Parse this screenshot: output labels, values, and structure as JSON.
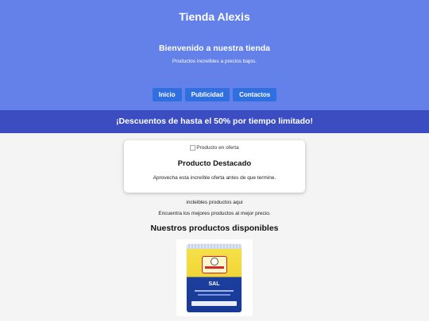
{
  "header": {
    "store_title": "Tienda Alexis",
    "welcome": "Bienvenido a nuestra tienda",
    "tagline": "Productos increíbles a precios bajos."
  },
  "nav": {
    "items": [
      {
        "label": "Inicio"
      },
      {
        "label": "Publicidad"
      },
      {
        "label": "Contactos"
      }
    ]
  },
  "promo": {
    "text": "¡Descuentos de hasta el 50% por tiempo limitado!"
  },
  "featured": {
    "image_alt": "Producto en oferta",
    "title": "Producto Destacado",
    "text": "Aprovecha esta increíble oferta antes de que termine."
  },
  "main": {
    "line1": "incleibles productos aqui",
    "line2": "Encuentra los mejores productos al mejor precio.",
    "products_title": "Nuestros productos disponibles"
  },
  "product": {
    "image_icon": "salt-package-image",
    "brand": "CRIS-SAL",
    "label": "SAL"
  },
  "colors": {
    "hero_bg": "#6381e8",
    "nav_button": "#2f6fe0",
    "promo_bg": "#3b4dc0",
    "page_bg": "#f4f4f4"
  }
}
